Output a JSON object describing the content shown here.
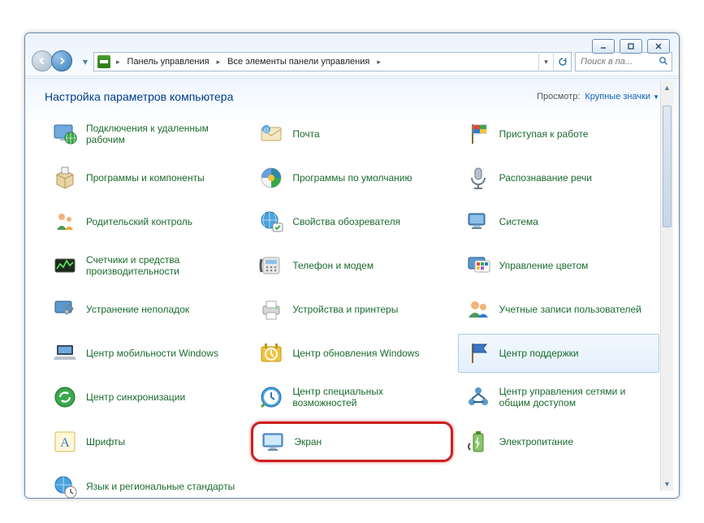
{
  "caption_buttons": {
    "minimize": "_",
    "maximize": "□",
    "close": "✕"
  },
  "breadcrumb": {
    "root": "Панель управления",
    "current": "Все элементы панели управления"
  },
  "search": {
    "placeholder": "Поиск в па..."
  },
  "header": {
    "title": "Настройка параметров компьютера",
    "view_label": "Просмотр:",
    "view_value": "Крупные значки"
  },
  "items": [
    {
      "id": "remote-connections",
      "label": "Подключения к удаленным рабочим",
      "icon": "screen-globe",
      "hover": false,
      "highlight": false
    },
    {
      "id": "mail",
      "label": "Почта",
      "icon": "envelope",
      "hover": false,
      "highlight": false
    },
    {
      "id": "getting-started",
      "label": "Приступая к работе",
      "icon": "flag-color",
      "hover": false,
      "highlight": false
    },
    {
      "id": "programs-features",
      "label": "Программы и компоненты",
      "icon": "box",
      "hover": false,
      "highlight": false
    },
    {
      "id": "default-programs",
      "label": "Программы по умолчанию",
      "icon": "app-default",
      "hover": false,
      "highlight": false
    },
    {
      "id": "speech-recognition",
      "label": "Распознавание речи",
      "icon": "mic",
      "hover": false,
      "highlight": false
    },
    {
      "id": "parental-controls",
      "label": "Родительский контроль",
      "icon": "family",
      "hover": false,
      "highlight": false
    },
    {
      "id": "internet-options",
      "label": "Свойства обозревателя",
      "icon": "globe-check",
      "hover": false,
      "highlight": false
    },
    {
      "id": "system",
      "label": "Система",
      "icon": "computer",
      "hover": false,
      "highlight": false
    },
    {
      "id": "performance-counters",
      "label": "Счетчики и средства производительности",
      "icon": "perf",
      "hover": false,
      "highlight": false
    },
    {
      "id": "phone-modem",
      "label": "Телефон и модем",
      "icon": "phone",
      "hover": false,
      "highlight": false
    },
    {
      "id": "color-management",
      "label": "Управление цветом",
      "icon": "palette",
      "hover": false,
      "highlight": false
    },
    {
      "id": "troubleshooting",
      "label": "Устранение неполадок",
      "icon": "wrench",
      "hover": false,
      "highlight": false
    },
    {
      "id": "devices-printers",
      "label": "Устройства и принтеры",
      "icon": "printer",
      "hover": false,
      "highlight": false
    },
    {
      "id": "user-accounts",
      "label": "Учетные записи пользователей",
      "icon": "users",
      "hover": false,
      "highlight": false
    },
    {
      "id": "mobility-center",
      "label": "Центр мобильности Windows",
      "icon": "laptop",
      "hover": false,
      "highlight": false
    },
    {
      "id": "windows-update",
      "label": "Центр обновления Windows",
      "icon": "update",
      "hover": false,
      "highlight": false
    },
    {
      "id": "action-center",
      "label": "Центр поддержки",
      "icon": "flag",
      "hover": true,
      "highlight": false
    },
    {
      "id": "sync-center",
      "label": "Центр синхронизации",
      "icon": "sync",
      "hover": false,
      "highlight": false
    },
    {
      "id": "ease-of-access",
      "label": "Центр специальных возможностей",
      "icon": "clock-access",
      "hover": false,
      "highlight": false
    },
    {
      "id": "network-sharing",
      "label": "Центр управления сетями и общим доступом",
      "icon": "network",
      "hover": false,
      "highlight": false
    },
    {
      "id": "fonts",
      "label": "Шрифты",
      "icon": "font",
      "hover": false,
      "highlight": false
    },
    {
      "id": "display",
      "label": "Экран",
      "icon": "monitor",
      "hover": false,
      "highlight": true
    },
    {
      "id": "power-options",
      "label": "Электропитание",
      "icon": "battery",
      "hover": false,
      "highlight": false
    },
    {
      "id": "region-language",
      "label": "Язык и региональные стандарты",
      "icon": "globe-clock",
      "hover": false,
      "highlight": false
    }
  ]
}
